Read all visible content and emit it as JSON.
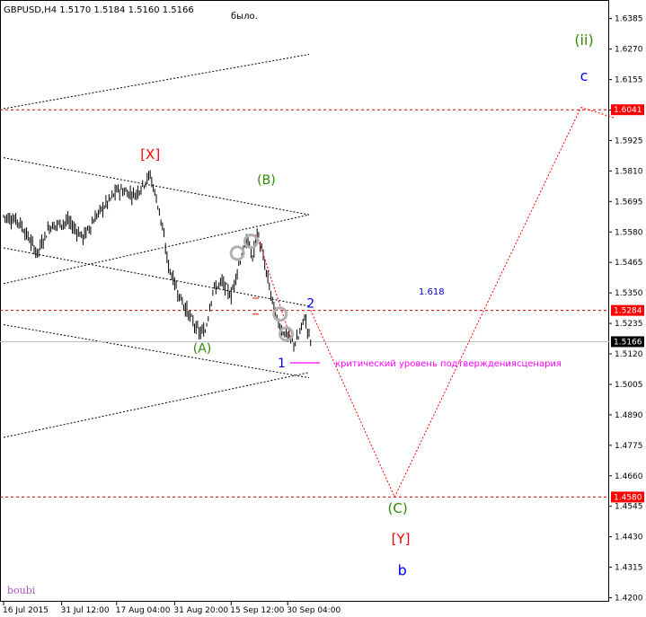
{
  "chart_data": {
    "type": "candlestick",
    "symbol_header": "GBPUSD,H4  1.5170 1.5184 1.5160 1.5166",
    "top_note": "было.",
    "watermark": "boubi",
    "colors": {
      "candle": "#000000",
      "levels": "#cc0000",
      "projection": "#ff0000",
      "current_line": "#c0c0c0",
      "tag_red": "#ff0000",
      "tag_black": "#000000"
    },
    "y_ticks": [
      "1.6385",
      "1.6270",
      "1.6155",
      "1.6040",
      "1.5925",
      "1.5810",
      "1.5695",
      "1.5580",
      "1.5465",
      "1.5350",
      "1.5235",
      "1.5120",
      "1.5005",
      "1.4890",
      "1.4775",
      "1.4660",
      "1.4545",
      "1.4430",
      "1.4315",
      "1.4200"
    ],
    "y_range": [
      1.4185,
      1.6455
    ],
    "x_ticks": [
      "16 Jul 2015",
      "31 Jul 12:00",
      "17 Aug 04:00",
      "31 Aug 20:00",
      "15 Sep 12:00",
      "30 Sep 04:00"
    ],
    "levels": [
      {
        "price": 1.6041,
        "label": "1.6041"
      },
      {
        "price": 1.5284,
        "label": "1.5284"
      },
      {
        "price": 1.458,
        "label": "1.4580"
      }
    ],
    "current_price": {
      "price": 1.5166,
      "label": "1.5166"
    },
    "fib_label": "1.618",
    "critical_text": "критический уровень подтверждениясценария",
    "path_anchors": [
      [
        0,
        1.564
      ],
      [
        10,
        1.562
      ],
      [
        22,
        1.55
      ],
      [
        30,
        1.56
      ],
      [
        42,
        1.562
      ],
      [
        52,
        1.556
      ],
      [
        62,
        1.565
      ],
      [
        75,
        1.574
      ],
      [
        86,
        1.572
      ],
      [
        96,
        1.5795
      ],
      [
        102,
        1.566
      ],
      [
        108,
        1.545
      ],
      [
        115,
        1.534
      ],
      [
        122,
        1.526
      ],
      [
        128,
        1.52
      ],
      [
        132,
        1.5205
      ],
      [
        137,
        1.536
      ],
      [
        143,
        1.539
      ],
      [
        149,
        1.534
      ],
      [
        154,
        1.546
      ],
      [
        160,
        1.555
      ],
      [
        163,
        1.548
      ],
      [
        166,
        1.5585
      ],
      [
        169,
        1.551
      ],
      [
        173,
        1.54
      ],
      [
        176,
        1.532
      ],
      [
        179,
        1.525
      ],
      [
        182,
        1.521
      ],
      [
        186,
        1.519
      ],
      [
        190,
        1.516
      ],
      [
        193,
        1.518
      ],
      [
        197,
        1.526
      ],
      [
        201,
        1.517
      ]
    ],
    "projection_path": [
      [
        201,
        1.5285
      ],
      [
        256,
        1.458
      ],
      [
        378,
        1.605
      ],
      [
        400,
        1.601
      ]
    ],
    "wave_labels": [
      {
        "text": "[X]",
        "color": "#ff0000",
        "size": 15,
        "at": [
          96,
          1.5855
        ]
      },
      {
        "text": "(B)",
        "color": "#2e8b00",
        "size": 14,
        "at": [
          172,
          1.576
        ]
      },
      {
        "text": "(A)",
        "color": "#2e8b00",
        "size": 14,
        "at": [
          130,
          1.5125
        ]
      },
      {
        "text": "2",
        "color": "#0000ff",
        "size": 14,
        "at": [
          201,
          1.5295
        ]
      },
      {
        "text": "1",
        "color": "#0000ff",
        "size": 14,
        "at": [
          182,
          1.507
        ]
      },
      {
        "text": "(ii)",
        "color": "#2e8b00",
        "size": 16,
        "at": [
          380,
          1.6285
        ]
      },
      {
        "text": "c",
        "color": "#0000ff",
        "size": 16,
        "at": [
          380,
          1.615
        ]
      },
      {
        "text": "(C)",
        "color": "#2e8b00",
        "size": 15,
        "at": [
          258,
          1.452
        ]
      },
      {
        "text": "[Y]",
        "color": "#ff0000",
        "size": 15,
        "at": [
          260,
          1.4405
        ]
      },
      {
        "text": "b",
        "color": "#0000ff",
        "size": 16,
        "at": [
          261,
          1.4285
        ]
      }
    ]
  }
}
